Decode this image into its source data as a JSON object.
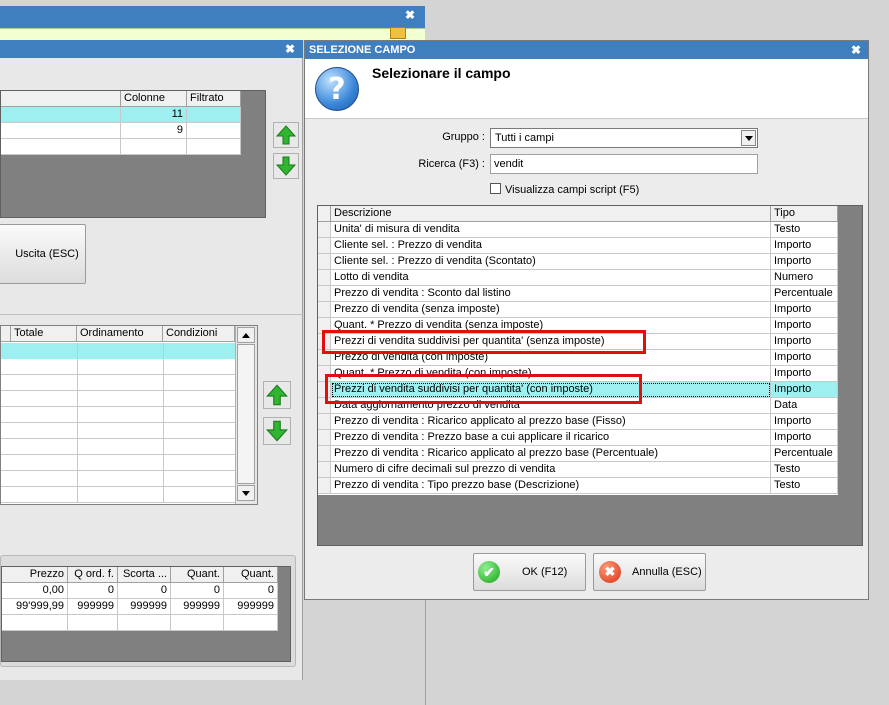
{
  "bg_window_top": {},
  "bg_window_main": {
    "top_grid": {
      "headers": [
        "Colonne",
        "Filtrato"
      ],
      "rows": [
        [
          "11",
          ""
        ],
        [
          "9",
          ""
        ]
      ]
    },
    "exit_button": "Uscita (ESC)",
    "mid_grid": {
      "headers": [
        "Totale",
        "Ordinamento",
        "Condizioni"
      ]
    },
    "bottom_grid": {
      "headers": [
        "Prezzo",
        "Q ord. f.",
        "Scorta ...",
        "Quant.",
        "Quant."
      ],
      "rows": [
        [
          "0,00",
          "0",
          "0",
          "0",
          "0"
        ],
        [
          "99'999,99",
          "999999",
          "999999",
          "999999",
          "999999"
        ]
      ]
    }
  },
  "dialog": {
    "title": "SELEZIONE CAMPO",
    "heading": "Selezionare il campo",
    "gruppo_label": "Gruppo :",
    "gruppo_value": "Tutti i campi",
    "ricerca_label": "Ricerca (F3) :",
    "ricerca_value": "vendit",
    "script_checkbox_label": "Visualizza campi script (F5)",
    "table": {
      "headers": [
        "Descrizione",
        "Tipo"
      ],
      "rows": [
        [
          "Unita' di misura di vendita",
          "Testo"
        ],
        [
          "Cliente sel. : Prezzo di vendita",
          "Importo"
        ],
        [
          "Cliente sel. : Prezzo di vendita (Scontato)",
          "Importo"
        ],
        [
          "Lotto di vendita",
          "Numero"
        ],
        [
          "Prezzo di vendita : Sconto dal listino",
          "Percentuale"
        ],
        [
          "Prezzo di vendita (senza imposte)",
          "Importo"
        ],
        [
          "Quant. * Prezzo di vendita (senza imposte)",
          "Importo"
        ],
        [
          "Prezzi di vendita suddivisi per quantita' (senza imposte)",
          "Importo"
        ],
        [
          "Prezzo di vendita (con imposte)",
          "Importo"
        ],
        [
          "Quant. * Prezzo di vendita (con imposte)",
          "Importo"
        ],
        [
          "Prezzi di vendita suddivisi per quantita' (con imposte)",
          "Importo"
        ],
        [
          "Data aggiornamento prezzo di vendita",
          "Data"
        ],
        [
          "Prezzo di vendita : Ricarico applicato al prezzo base (Fisso)",
          "Importo"
        ],
        [
          "Prezzo di vendita : Prezzo base a cui applicare il ricarico",
          "Importo"
        ],
        [
          "Prezzo di vendita : Ricarico applicato al prezzo base (Percentuale)",
          "Percentuale"
        ],
        [
          "Numero di cifre decimali sul prezzo di vendita",
          "Testo"
        ],
        [
          "Prezzo di vendita : Tipo prezzo base (Descrizione)",
          "Testo"
        ]
      ],
      "selected_index": 10
    },
    "ok_button": "OK (F12)",
    "cancel_button": "Annulla (ESC)"
  },
  "colors": {
    "title_bar": "#3f7fc0",
    "selection": "#9eefef",
    "highlight_box": "#e01010",
    "grid_dark": "#808080"
  }
}
